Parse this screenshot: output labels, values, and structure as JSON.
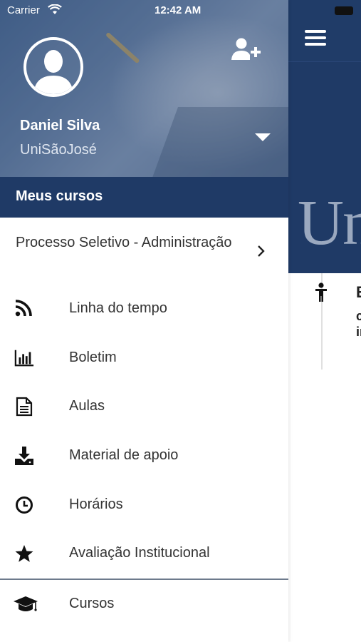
{
  "status_bar": {
    "carrier": "Carrier",
    "time": "12:42 AM"
  },
  "profile": {
    "name": "Daniel Silva",
    "org": "UniSãoJosé"
  },
  "section": {
    "title": "Meus cursos"
  },
  "course": {
    "name": "Processo Seletivo - Administração"
  },
  "menu": [
    {
      "label": "Linha do tempo",
      "icon": "rss-icon"
    },
    {
      "label": "Boletim",
      "icon": "bar-chart-icon"
    },
    {
      "label": "Aulas",
      "icon": "document-icon"
    },
    {
      "label": "Material de apoio",
      "icon": "download-icon"
    },
    {
      "label": "Horários",
      "icon": "clock-icon"
    },
    {
      "label": "Avaliação Institucional",
      "icon": "star-icon"
    },
    {
      "label": "Cursos",
      "icon": "graduation-cap-icon"
    }
  ],
  "background_screen": {
    "logo_fragment": "Un",
    "peek_title": "E",
    "peek_line1": "c",
    "peek_line2": "ir"
  },
  "colors": {
    "primary": "#1f3a66",
    "text": "#333333",
    "divider": "#6d7a8c"
  }
}
